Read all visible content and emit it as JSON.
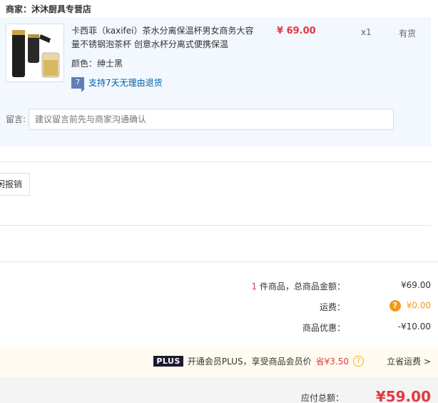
{
  "store": {
    "label": "商家：沐沐厨具专营店"
  },
  "item": {
    "title": "卡西菲（kaxifei）茶水分离保温杯男女商务大容量不锈钢泡茶杯 创意水杯分离式便携保温",
    "color": "颜色：绅士黑",
    "price": "¥ 69.00",
    "quantity": "x1",
    "stock": "有货",
    "return_policy": "支持7天无理由退货",
    "return_icon": "7"
  },
  "message": {
    "label": "留言:",
    "placeholder": "建议留言前先与商家沟通确认"
  },
  "invoice_button": "闲报销",
  "summary": {
    "count": "1",
    "count_suffix": "件商品，总商品金额：",
    "subtotal": "¥69.00",
    "shipping_label": "运费：",
    "shipping_value": "¥0.00",
    "discount_label": "商品优惠：",
    "discount_value": "-¥10.00"
  },
  "plus": {
    "badge": "PLUS",
    "text": "开通会员PLUS，享受商品会员价",
    "save": "省¥3.50",
    "link": "立省运费 >"
  },
  "total": {
    "label": "应付总额：",
    "value": "¥59.00"
  },
  "colors": {
    "accent_red": "#e4393c",
    "orange": "#f09a1b",
    "panel_blue": "#f2f8fe"
  }
}
